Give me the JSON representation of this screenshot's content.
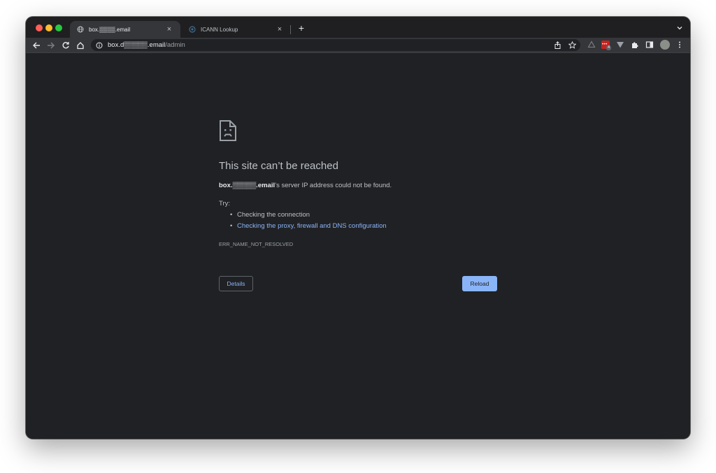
{
  "tabs": [
    {
      "title": "box.▒▒▒▒.email",
      "active": true,
      "favicon": "globe-icon"
    },
    {
      "title": "ICANN Lookup",
      "active": false,
      "favicon": "icann-icon"
    }
  ],
  "new_tab_label": "+",
  "close_glyph": "×",
  "omnibox": {
    "host": "box.d▒▒▒▒▒.email",
    "path": "/admin"
  },
  "extensions": {
    "badge_count": "4"
  },
  "error_page": {
    "icon": "sad-page-icon",
    "headline": "This site can’t be reached",
    "host_bold": "box.▒▒▒▒▒.email",
    "detail_suffix": "’s server IP address could not be found.",
    "try_label": "Try:",
    "suggestions": [
      "Checking the connection",
      "Checking the proxy, firewall and DNS configuration"
    ],
    "error_code": "ERR_NAME_NOT_RESOLVED",
    "details_button": "Details",
    "reload_button": "Reload"
  },
  "colors": {
    "page_bg": "#202124",
    "text": "#bdc1c6",
    "link": "#8ab4f8",
    "primary_button": "#8ab4f8"
  }
}
